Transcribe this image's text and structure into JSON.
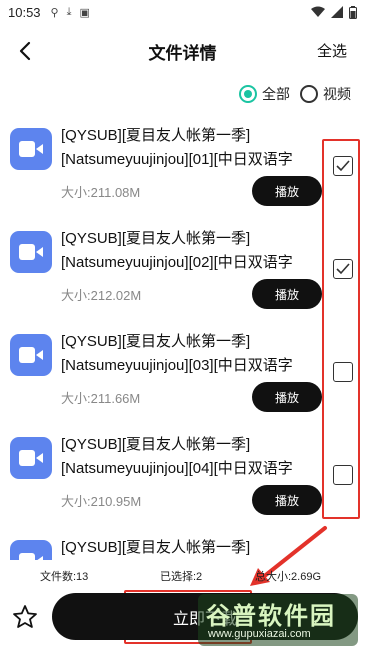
{
  "status_bar": {
    "time": "10:53"
  },
  "header": {
    "title": "文件详情",
    "select_all": "全选"
  },
  "filter": {
    "options": [
      {
        "label": "全部",
        "selected": true
      },
      {
        "label": "视频",
        "selected": false
      }
    ]
  },
  "files": [
    {
      "line1": "[QYSUB][夏目友人帐第一季]",
      "line2": "[Natsumeyuujinjou][01][中日双语字",
      "size": "大小:211.08M",
      "play": "播放",
      "checked": true
    },
    {
      "line1": "[QYSUB][夏目友人帐第一季]",
      "line2": "[Natsumeyuujinjou][02][中日双语字",
      "size": "大小:212.02M",
      "play": "播放",
      "checked": true
    },
    {
      "line1": "[QYSUB][夏目友人帐第一季]",
      "line2": "[Natsumeyuujinjou][03][中日双语字",
      "size": "大小:211.66M",
      "play": "播放",
      "checked": false
    },
    {
      "line1": "[QYSUB][夏目友人帐第一季]",
      "line2": "[Natsumeyuujinjou][04][中日双语字",
      "size": "大小:210.95M",
      "play": "播放",
      "checked": false
    },
    {
      "line1": "[QYSUB][夏目友人帐第一季]",
      "line2": "",
      "size": "",
      "play": "",
      "checked": false
    }
  ],
  "stats": {
    "file_count": "文件数:13",
    "selected": "已选择:2",
    "total_size": "总大小:2.69G"
  },
  "footer": {
    "download_label": "立即下载"
  },
  "watermark": {
    "text": "谷普软件园",
    "url": "www.gupuxiazai.com"
  },
  "colors": {
    "accent": "#1bc4a2",
    "video_icon": "#5d84ee",
    "highlight": "#e3322a"
  },
  "icons": {
    "back": "back-arrow-icon",
    "video": "video-camera-icon",
    "star": "star-icon"
  }
}
